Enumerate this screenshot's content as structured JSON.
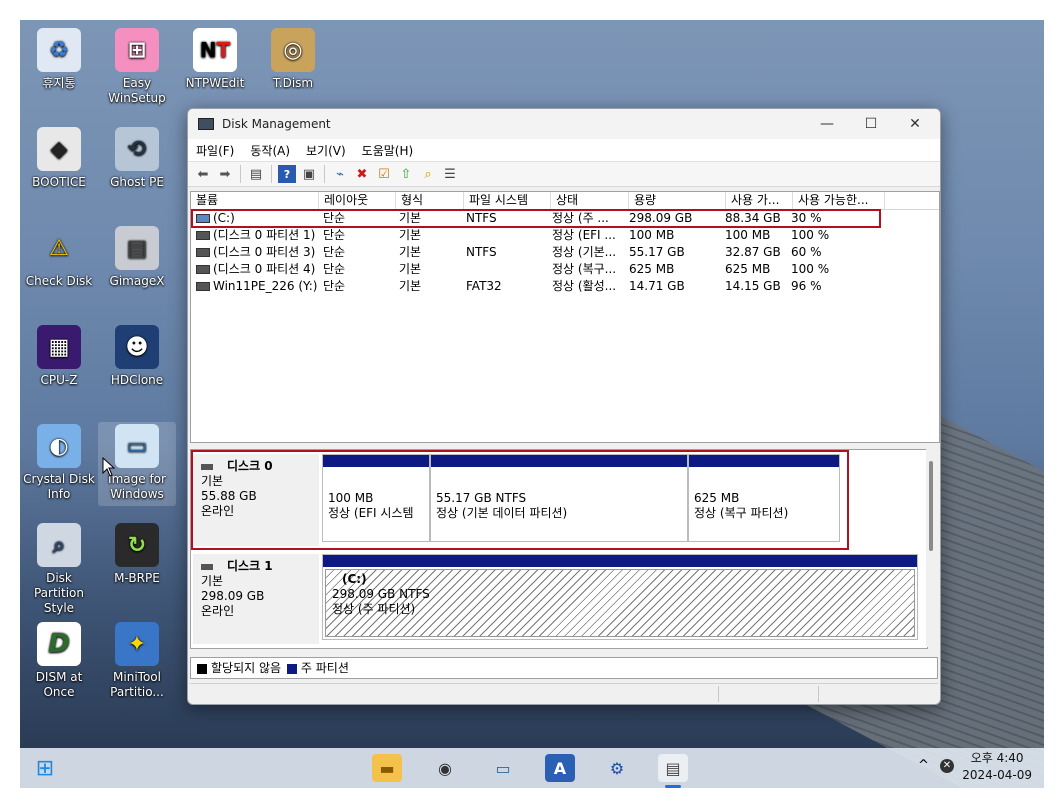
{
  "desktop": {
    "icons": [
      {
        "label": "휴지통",
        "glyph": "♻"
      },
      {
        "label": "Easy WinSetup",
        "glyph": "⊞"
      },
      {
        "label": "NTPWEdit",
        "glyph": "NT"
      },
      {
        "label": "T.Dism",
        "glyph": "◎"
      },
      {
        "label": "BOOTICE",
        "glyph": "◆"
      },
      {
        "label": "Ghost PE",
        "glyph": "⟲"
      },
      {
        "label": "Check Disk",
        "glyph": "⚠"
      },
      {
        "label": "GimageX",
        "glyph": "▤"
      },
      {
        "label": "CPU-Z",
        "glyph": "▦"
      },
      {
        "label": "HDClone",
        "glyph": "☻"
      },
      {
        "label": "Crystal Disk Info",
        "glyph": "◐"
      },
      {
        "label": "Image for Windows",
        "glyph": "▭"
      },
      {
        "label": "Disk Partition Style",
        "glyph": "⌕"
      },
      {
        "label": "M-BRPE",
        "glyph": "↻"
      },
      {
        "label": "DISM at Once",
        "glyph": "D"
      },
      {
        "label": "MiniTool Partitio...",
        "glyph": "✦"
      }
    ]
  },
  "window": {
    "title": "Disk Management",
    "controls": {
      "minimize": "—",
      "maximize": "☐",
      "close": "✕"
    },
    "menu": [
      "파일(F)",
      "동작(A)",
      "보기(V)",
      "도움말(H)"
    ],
    "columns": [
      "볼륨",
      "레이아웃",
      "형식",
      "파일 시스템",
      "상태",
      "용량",
      "사용 가...",
      "사용 가능한..."
    ],
    "volumes": [
      {
        "name": "(C:)",
        "layout": "단순",
        "type": "기본",
        "fs": "NTFS",
        "status": "정상 (주 ...",
        "capacity": "298.09 GB",
        "free": "88.34 GB",
        "pct": "30 %"
      },
      {
        "name": "(디스크 0 파티션 1)",
        "layout": "단순",
        "type": "기본",
        "fs": "",
        "status": "정상 (EFI ...",
        "capacity": "100 MB",
        "free": "100 MB",
        "pct": "100 %"
      },
      {
        "name": "(디스크 0 파티션 3)",
        "layout": "단순",
        "type": "기본",
        "fs": "NTFS",
        "status": "정상 (기본...",
        "capacity": "55.17 GB",
        "free": "32.87 GB",
        "pct": "60 %"
      },
      {
        "name": "(디스크 0 파티션 4)",
        "layout": "단순",
        "type": "기본",
        "fs": "",
        "status": "정상 (복구...",
        "capacity": "625 MB",
        "free": "625 MB",
        "pct": "100 %"
      },
      {
        "name": "Win11PE_226 (Y:)",
        "layout": "단순",
        "type": "기본",
        "fs": "FAT32",
        "status": "정상 (활성...",
        "capacity": "14.71 GB",
        "free": "14.15 GB",
        "pct": "96 %"
      }
    ],
    "disks": [
      {
        "name": "디스크 0",
        "type": "기본",
        "size": "55.88 GB",
        "state": "온라인",
        "partitions": [
          {
            "line1": "100 MB",
            "line2": "정상 (EFI 시스템"
          },
          {
            "line1": "55.17 GB NTFS",
            "line2": "정상 (기본 데이터 파티션)"
          },
          {
            "line1": "625 MB",
            "line2": "정상 (복구 파티션)"
          }
        ]
      },
      {
        "name": "디스크 1",
        "type": "기본",
        "size": "298.09 GB",
        "state": "온라인",
        "partitions": [
          {
            "title": "(C:)",
            "line1": "298.09 GB NTFS",
            "line2": "정상 (주 파티션)"
          }
        ]
      }
    ],
    "legend": [
      {
        "label": "할당되지 않음",
        "color": "#000000"
      },
      {
        "label": "주 파티션",
        "color": "#0d1a84"
      }
    ]
  },
  "taskbar": {
    "clock_time": "오후 4:40",
    "clock_date": "2024-04-09",
    "tray_chevron": "^"
  }
}
